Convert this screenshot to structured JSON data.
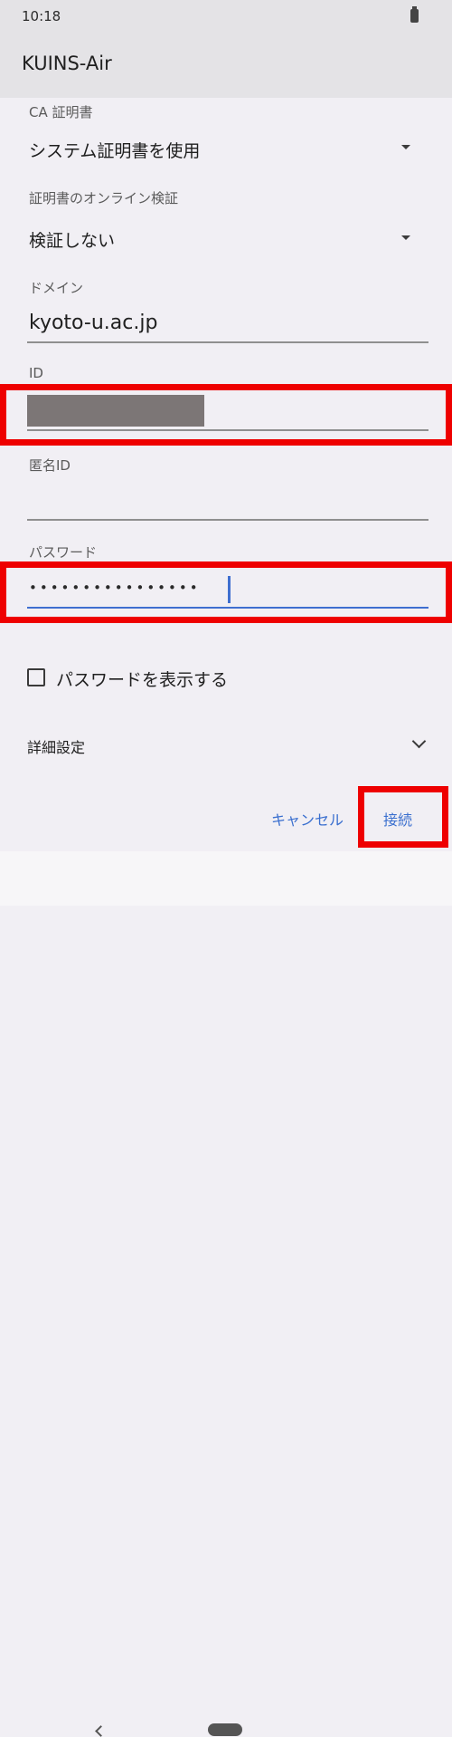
{
  "status_bar": {
    "time": "10:18"
  },
  "dialog": {
    "title": "KUINS-Air"
  },
  "fields": {
    "ca_cert": {
      "label": "CA 証明書",
      "value": "システム証明書を使用"
    },
    "online_verify": {
      "label": "証明書のオンライン検証",
      "value": "検証しない"
    },
    "domain": {
      "label": "ドメイン",
      "value": "kyoto-u.ac.jp"
    },
    "id": {
      "label": "ID",
      "value": ""
    },
    "anonymous_id": {
      "label": "匿名ID",
      "value": ""
    },
    "password": {
      "label": "パスワード",
      "value": "••••••••••••••••"
    }
  },
  "show_password": {
    "label": "パスワードを表示する",
    "checked": false
  },
  "advanced": {
    "label": "詳細設定"
  },
  "buttons": {
    "cancel": "キャンセル",
    "connect": "接続"
  },
  "colors": {
    "accent": "#3f6fd0",
    "highlight": "#ee0000"
  },
  "icons": [
    "battery-icon",
    "dropdown-arrow-icon",
    "checkbox-icon",
    "chevron-down-icon",
    "back-icon",
    "home-icon"
  ]
}
